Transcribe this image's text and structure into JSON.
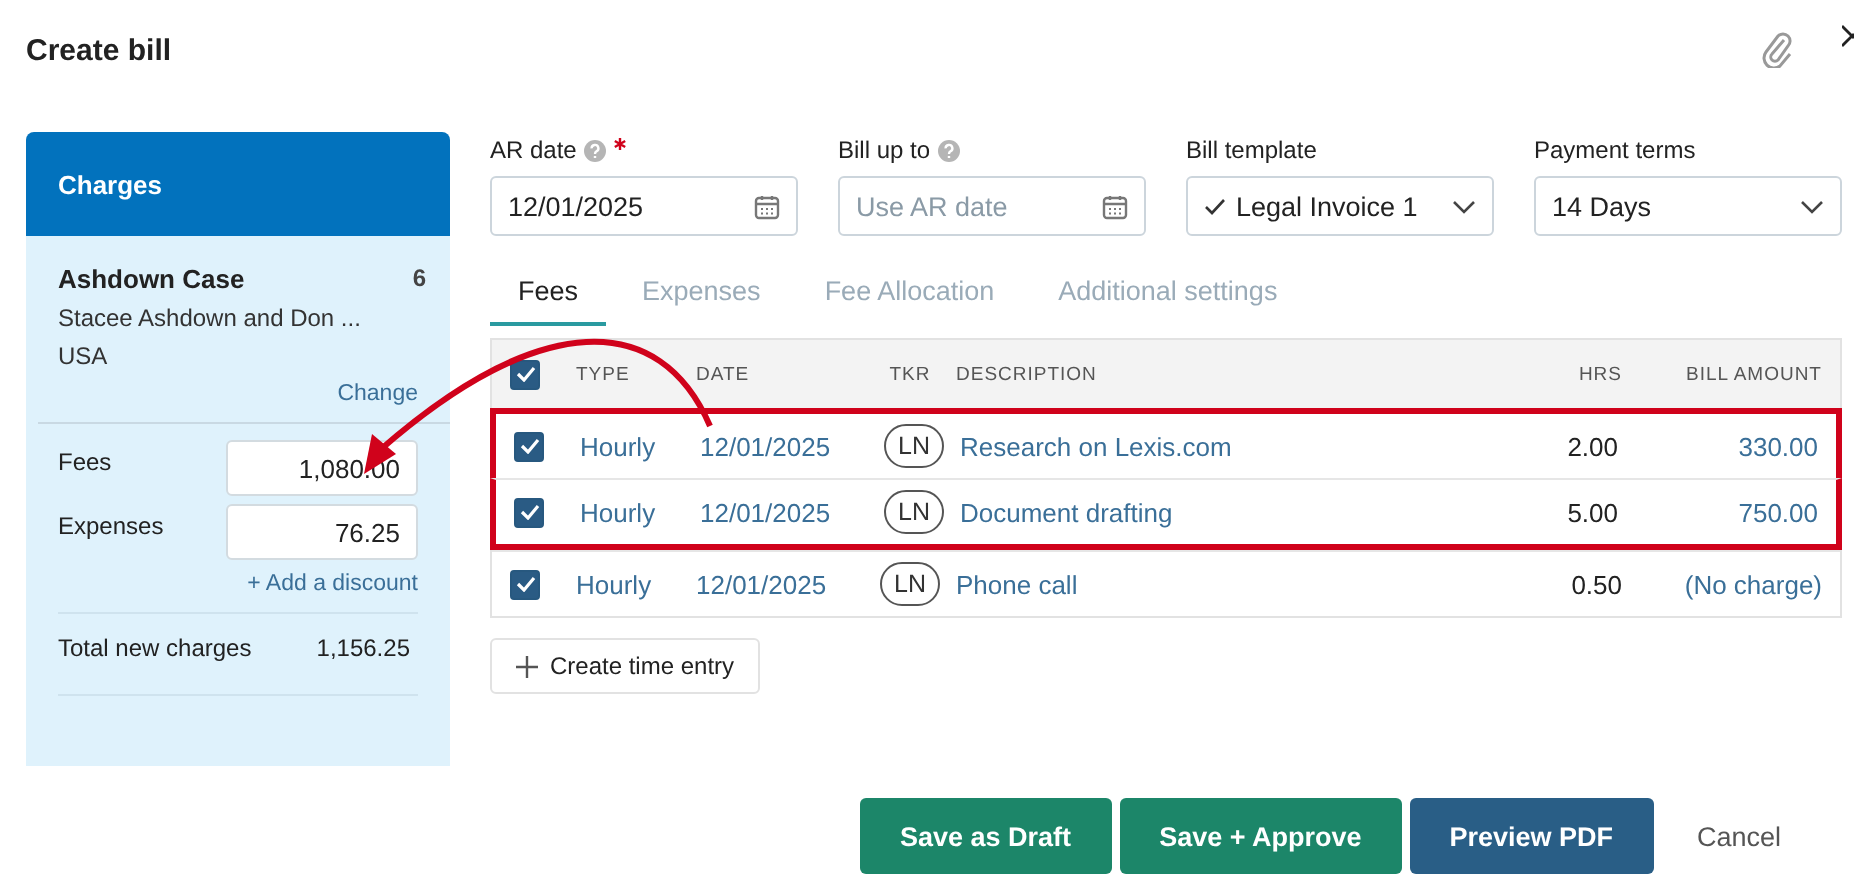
{
  "title": "Create bill",
  "charges": {
    "header": "Charges",
    "matter": "Ashdown Case",
    "matter_count": "6",
    "client": "Stacee Ashdown and Don ...",
    "country": "USA",
    "change_link": "Change",
    "fields": [
      {
        "label": "Fees",
        "value": "1,080.00"
      },
      {
        "label": "Expenses",
        "value": "76.25"
      }
    ],
    "discount_link": "+ Add a discount",
    "total_label": "Total new charges",
    "total_value": "1,156.25"
  },
  "form": [
    {
      "label": "AR date",
      "help": true,
      "required": true,
      "kind": "date",
      "value": "12/01/2025"
    },
    {
      "label": "Bill up to",
      "help": true,
      "required": false,
      "kind": "date",
      "placeholder": "Use AR date"
    },
    {
      "label": "Bill template",
      "help": false,
      "required": false,
      "kind": "select",
      "value": "Legal Invoice 1",
      "check": true
    },
    {
      "label": "Payment terms",
      "help": false,
      "required": false,
      "kind": "select",
      "value": "14 Days",
      "check": false
    }
  ],
  "tabs": [
    {
      "label": "Fees",
      "selected": true
    },
    {
      "label": "Expenses",
      "selected": false
    },
    {
      "label": "Fee Allocation",
      "selected": false
    },
    {
      "label": "Additional settings",
      "selected": false
    }
  ],
  "table": {
    "all_checked": true,
    "columns": [
      "TYPE",
      "DATE",
      "TKR",
      "DESCRIPTION",
      "HRS",
      "BILL AMOUNT"
    ],
    "rows": [
      {
        "checked": true,
        "highlighted": true,
        "type": "Hourly",
        "date": "12/01/2025",
        "tkr": "LN",
        "description": "Research on Lexis.com",
        "hrs": "2.00",
        "amount": "330.00"
      },
      {
        "checked": true,
        "highlighted": true,
        "type": "Hourly",
        "date": "12/01/2025",
        "tkr": "LN",
        "description": "Document drafting",
        "hrs": "5.00",
        "amount": "750.00"
      },
      {
        "checked": true,
        "highlighted": false,
        "type": "Hourly",
        "date": "12/01/2025",
        "tkr": "LN",
        "description": "Phone call",
        "hrs": "0.50",
        "amount": "(No charge)"
      }
    ]
  },
  "create_button": "Create time entry",
  "buttons": [
    {
      "label": "Save as Draft",
      "kind": "green"
    },
    {
      "label": "Save + Approve",
      "kind": "green"
    },
    {
      "label": "Preview PDF",
      "kind": "blue"
    },
    {
      "label": "Cancel",
      "kind": "plain"
    }
  ]
}
